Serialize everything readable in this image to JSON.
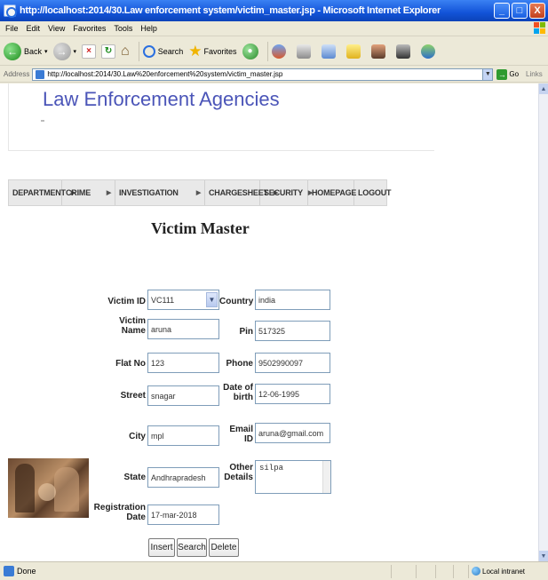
{
  "window": {
    "title": "http://localhost:2014/30.Law enforcement system/victim_master.jsp - Microsoft Internet Explorer",
    "min_label": "_",
    "max_label": "□",
    "close_label": "X"
  },
  "menubar": [
    "File",
    "Edit",
    "View",
    "Favorites",
    "Tools",
    "Help"
  ],
  "toolbar": {
    "back_label": "Back",
    "search_label": "Search",
    "favorites_label": "Favorites"
  },
  "addressbar": {
    "label": "Address",
    "url": "http://localhost:2014/30.Law%20enforcement%20system/victim_master.jsp",
    "go_label": "Go",
    "links_label": "Links"
  },
  "page": {
    "header_title": "Law Enforcement Agencies",
    "nav": [
      {
        "label": "DEPARTMENT",
        "arrow": true
      },
      {
        "label": "CRIME",
        "arrow": true
      },
      {
        "label": "INVESTIGATION",
        "arrow": true
      },
      {
        "label": "CHARGESHEET",
        "arrow": true
      },
      {
        "label": "SECURITY",
        "arrow": true
      },
      {
        "label": "HOMEPAGE",
        "arrow": false
      },
      {
        "label": "LOGOUT",
        "arrow": false
      }
    ],
    "form_title": "Victim Master"
  },
  "form": {
    "victim_id": {
      "label": "Victim ID",
      "value": "VC111"
    },
    "victim_name": {
      "label": "Victim Name",
      "value": "aruna"
    },
    "flat_no": {
      "label": "Flat No",
      "value": "123"
    },
    "street": {
      "label": "Street",
      "value": "snagar"
    },
    "city": {
      "label": "City",
      "value": "mpl"
    },
    "state": {
      "label": "State",
      "value": "Andhrapradesh"
    },
    "registration_date": {
      "label": "Registration Date",
      "value": "17-mar-2018"
    },
    "country": {
      "label": "Country",
      "value": "india"
    },
    "pin": {
      "label": "Pin",
      "value": "517325"
    },
    "phone": {
      "label": "Phone",
      "value": "9502990097"
    },
    "dob": {
      "label": "Date of birth",
      "value": "12-06-1995"
    },
    "email": {
      "label": "Email ID",
      "value": "aruna@gmail.com"
    },
    "other_details": {
      "label": "Other Details",
      "value": "silpa"
    },
    "buttons": {
      "insert": "Insert",
      "search": "Search",
      "delete": "Delete"
    }
  },
  "statusbar": {
    "status": "Done",
    "zone": "Local intranet"
  },
  "colors": {
    "title_bar": "#1253d8",
    "header_text": "#4b55b8",
    "field_border": "#7f9db9"
  }
}
